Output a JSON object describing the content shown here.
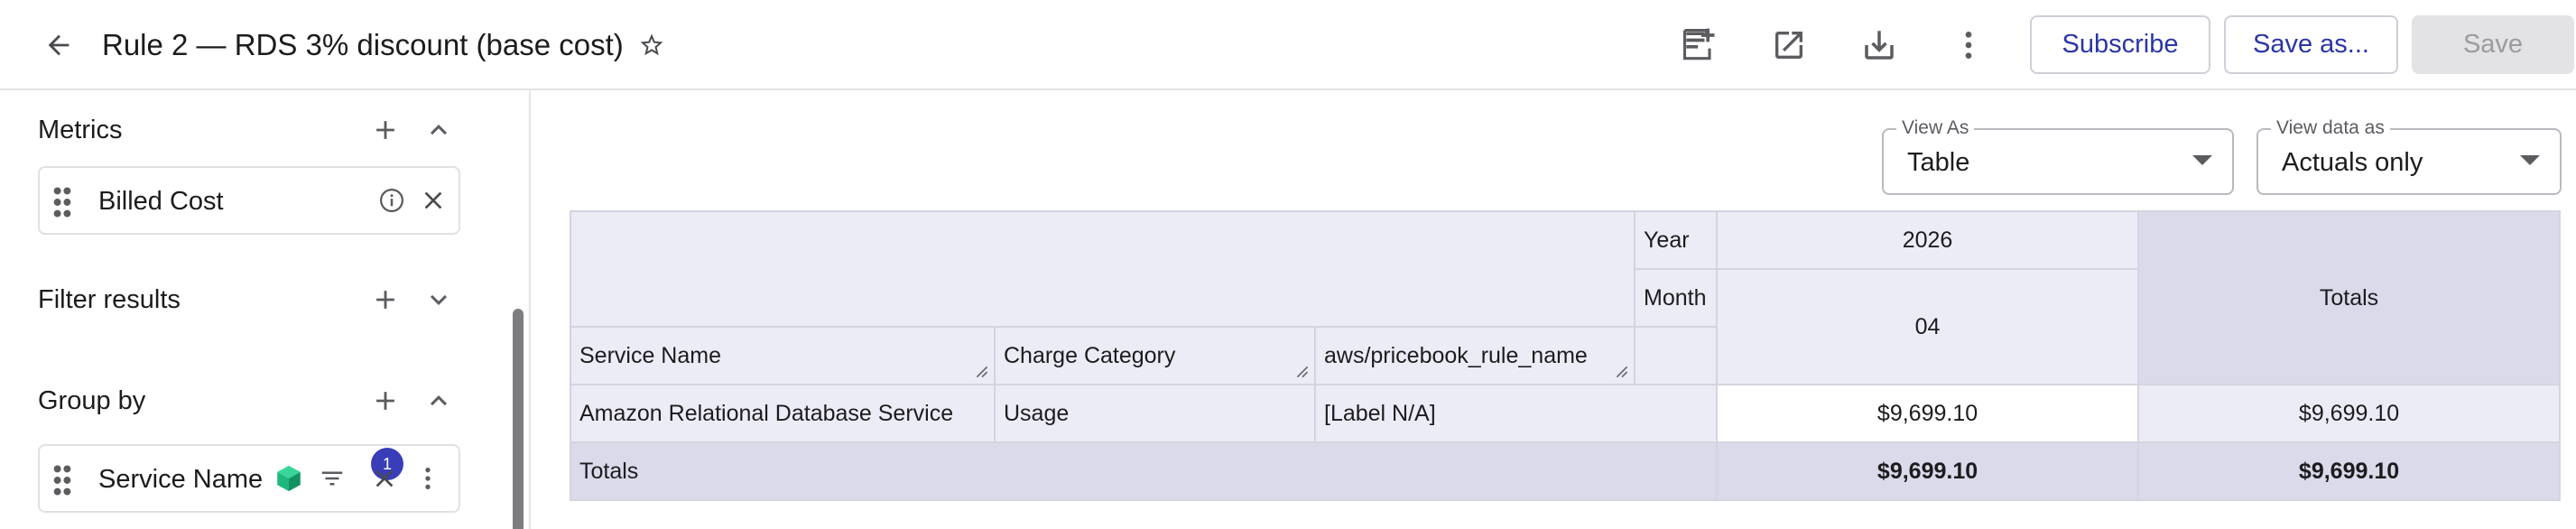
{
  "header": {
    "title": "Rule 2 — RDS 3% discount (base cost)",
    "actions": {
      "subscribe_label": "Subscribe",
      "save_as_label": "Save as...",
      "save_label": "Save"
    },
    "icons": [
      "arrow-back-icon",
      "star-outline-icon",
      "add-to-dashboard-icon",
      "open-in-new-icon",
      "download-icon",
      "more-vert-icon"
    ]
  },
  "sidebar": {
    "metrics": {
      "title": "Metrics",
      "items": [
        {
          "label": "Billed Cost"
        }
      ]
    },
    "filter_results": {
      "title": "Filter results"
    },
    "group_by": {
      "title": "Group by",
      "items": [
        {
          "label": "Service Name",
          "filter_count": "1"
        }
      ]
    }
  },
  "main": {
    "view_as": {
      "label": "View As",
      "value": "Table"
    },
    "view_data_as": {
      "label": "View data as",
      "value": "Actuals only"
    },
    "table": {
      "year_label": "Year",
      "year_value": "2026",
      "month_label": "Month",
      "month_value": "04",
      "totals_column_label": "Totals",
      "dimension_headers": [
        "Service Name",
        "Charge Category",
        "aws/pricebook_rule_name"
      ],
      "rows": [
        {
          "service_name": "Amazon Relational Database Service",
          "charge_category": "Usage",
          "rule_name": "[Label N/A]",
          "month_value": "$9,699.10",
          "total": "$9,699.10"
        }
      ],
      "totals_row": {
        "label": "Totals",
        "month_value": "$9,699.10",
        "total": "$9,699.10"
      }
    }
  },
  "colors": {
    "accent": "#2b35a6",
    "badge": "#3a3db8",
    "cube_icon": "#1db87a",
    "table_header_bg": "#ececf6",
    "table_totals_bg": "#dadaea",
    "border": "#d4d4e0"
  }
}
